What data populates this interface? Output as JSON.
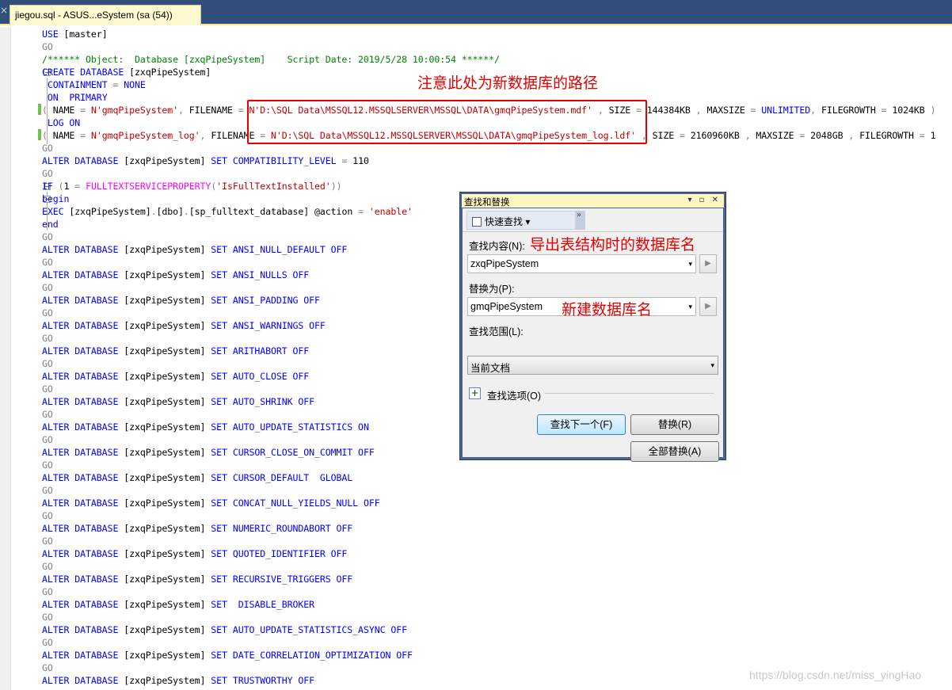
{
  "tab": {
    "title": "jiegou.sql - ASUS...eSystem (sa (54))",
    "close": "×"
  },
  "code": [
    [
      [
        "k",
        "USE "
      ],
      [
        "p",
        "[master]"
      ]
    ],
    [
      [
        "g",
        "GO"
      ]
    ],
    [
      [
        "c",
        "/****** Object:  Database [zxqPipeSystem]    Script Date: 2019/5/28 10:00:54 ******/"
      ]
    ],
    [
      [
        "k",
        "CREATE DATABASE "
      ],
      [
        "p",
        "[zxqPipeSystem]"
      ]
    ],
    [
      [
        "p",
        " "
      ],
      [
        "k",
        "CONTAINMENT "
      ],
      [
        "g",
        "= "
      ],
      [
        "k",
        "NONE"
      ]
    ],
    [
      [
        "p",
        " "
      ],
      [
        "k",
        "ON  PRIMARY"
      ]
    ],
    [
      [
        "g",
        "( "
      ],
      [
        "p",
        "NAME "
      ],
      [
        "g",
        "= "
      ],
      [
        "s",
        "N'gmqPipeSystem'"
      ],
      [
        "g",
        ", "
      ],
      [
        "p",
        "FILENAME "
      ],
      [
        "g",
        "= "
      ],
      [
        "s",
        "N'D:\\SQL Data\\MSSQL12.MSSQLSERVER\\MSSQL\\DATA\\gmqPipeSystem.mdf'"
      ],
      [
        "g",
        " , "
      ],
      [
        "p",
        "SIZE "
      ],
      [
        "g",
        "= "
      ],
      [
        "p",
        "144384KB "
      ],
      [
        "g",
        ", "
      ],
      [
        "p",
        "MAXSIZE "
      ],
      [
        "g",
        "= "
      ],
      [
        "k",
        "UNLIMITED"
      ],
      [
        "g",
        ", "
      ],
      [
        "p",
        "FILEGROWTH "
      ],
      [
        "g",
        "= "
      ],
      [
        "p",
        "1024KB "
      ],
      [
        "g",
        ")"
      ]
    ],
    [
      [
        "p",
        " "
      ],
      [
        "k",
        "LOG ON"
      ]
    ],
    [
      [
        "g",
        "( "
      ],
      [
        "p",
        "NAME "
      ],
      [
        "g",
        "= "
      ],
      [
        "s",
        "N'gmqPipeSystem_log'"
      ],
      [
        "g",
        ", "
      ],
      [
        "p",
        "FILENAME "
      ],
      [
        "g",
        "= "
      ],
      [
        "s",
        "N'D:\\SQL Data\\MSSQL12.MSSQLSERVER\\MSSQL\\DATA\\gmqPipeSystem_log.ldf'"
      ],
      [
        "g",
        " , "
      ],
      [
        "p",
        "SIZE "
      ],
      [
        "g",
        "= "
      ],
      [
        "p",
        "2160960KB "
      ],
      [
        "g",
        ", "
      ],
      [
        "p",
        "MAXSIZE "
      ],
      [
        "g",
        "= "
      ],
      [
        "p",
        "2048GB "
      ],
      [
        "g",
        ", "
      ],
      [
        "p",
        "FILEGROWTH "
      ],
      [
        "g",
        "= "
      ],
      [
        "p",
        "1"
      ]
    ],
    [
      [
        "g",
        "GO"
      ]
    ],
    [
      [
        "k",
        "ALTER DATABASE "
      ],
      [
        "p",
        "[zxqPipeSystem] "
      ],
      [
        "k",
        "SET "
      ],
      [
        "k",
        "COMPATIBILITY_LEVEL "
      ],
      [
        "g",
        "= "
      ],
      [
        "p",
        "110"
      ]
    ],
    [
      [
        "g",
        "GO"
      ]
    ],
    [
      [
        "k",
        "IF "
      ],
      [
        "g",
        "("
      ],
      [
        "p",
        "1 "
      ],
      [
        "g",
        "= "
      ],
      [
        "m",
        "FULLTEXTSERVICEPROPERTY"
      ],
      [
        "g",
        "("
      ],
      [
        "s",
        "'IsFullTextInstalled'"
      ],
      [
        "g",
        "))"
      ]
    ],
    [
      [
        "k",
        "begin"
      ]
    ],
    [
      [
        "k",
        "EXEC "
      ],
      [
        "p",
        "[zxqPipeSystem]"
      ],
      [
        "g",
        "."
      ],
      [
        "p",
        "[dbo]"
      ],
      [
        "g",
        "."
      ],
      [
        "p",
        "[sp_fulltext_database] @action "
      ],
      [
        "g",
        "= "
      ],
      [
        "s",
        "'enable'"
      ]
    ],
    [
      [
        "k",
        "end"
      ]
    ],
    [
      [
        "g",
        "GO"
      ]
    ],
    [
      [
        "k",
        "ALTER DATABASE "
      ],
      [
        "p",
        "[zxqPipeSystem] "
      ],
      [
        "k",
        "SET ANSI_NULL_DEFAULT OFF"
      ]
    ],
    [
      [
        "g",
        "GO"
      ]
    ],
    [
      [
        "k",
        "ALTER DATABASE "
      ],
      [
        "p",
        "[zxqPipeSystem] "
      ],
      [
        "k",
        "SET ANSI_NULLS OFF"
      ]
    ],
    [
      [
        "g",
        "GO"
      ]
    ],
    [
      [
        "k",
        "ALTER DATABASE "
      ],
      [
        "p",
        "[zxqPipeSystem] "
      ],
      [
        "k",
        "SET ANSI_PADDING OFF"
      ]
    ],
    [
      [
        "g",
        "GO"
      ]
    ],
    [
      [
        "k",
        "ALTER DATABASE "
      ],
      [
        "p",
        "[zxqPipeSystem] "
      ],
      [
        "k",
        "SET ANSI_WARNINGS OFF"
      ]
    ],
    [
      [
        "g",
        "GO"
      ]
    ],
    [
      [
        "k",
        "ALTER DATABASE "
      ],
      [
        "p",
        "[zxqPipeSystem] "
      ],
      [
        "k",
        "SET ARITHABORT OFF"
      ]
    ],
    [
      [
        "g",
        "GO"
      ]
    ],
    [
      [
        "k",
        "ALTER DATABASE "
      ],
      [
        "p",
        "[zxqPipeSystem] "
      ],
      [
        "k",
        "SET AUTO_CLOSE OFF"
      ]
    ],
    [
      [
        "g",
        "GO"
      ]
    ],
    [
      [
        "k",
        "ALTER DATABASE "
      ],
      [
        "p",
        "[zxqPipeSystem] "
      ],
      [
        "k",
        "SET AUTO_SHRINK OFF"
      ]
    ],
    [
      [
        "g",
        "GO"
      ]
    ],
    [
      [
        "k",
        "ALTER DATABASE "
      ],
      [
        "p",
        "[zxqPipeSystem] "
      ],
      [
        "k",
        "SET AUTO_UPDATE_STATISTICS ON"
      ]
    ],
    [
      [
        "g",
        "GO"
      ]
    ],
    [
      [
        "k",
        "ALTER DATABASE "
      ],
      [
        "p",
        "[zxqPipeSystem] "
      ],
      [
        "k",
        "SET CURSOR_CLOSE_ON_COMMIT OFF"
      ]
    ],
    [
      [
        "g",
        "GO"
      ]
    ],
    [
      [
        "k",
        "ALTER DATABASE "
      ],
      [
        "p",
        "[zxqPipeSystem] "
      ],
      [
        "k",
        "SET CURSOR_DEFAULT  GLOBAL"
      ]
    ],
    [
      [
        "g",
        "GO"
      ]
    ],
    [
      [
        "k",
        "ALTER DATABASE "
      ],
      [
        "p",
        "[zxqPipeSystem] "
      ],
      [
        "k",
        "SET CONCAT_NULL_YIELDS_NULL OFF"
      ]
    ],
    [
      [
        "g",
        "GO"
      ]
    ],
    [
      [
        "k",
        "ALTER DATABASE "
      ],
      [
        "p",
        "[zxqPipeSystem] "
      ],
      [
        "k",
        "SET NUMERIC_ROUNDABORT OFF"
      ]
    ],
    [
      [
        "g",
        "GO"
      ]
    ],
    [
      [
        "k",
        "ALTER DATABASE "
      ],
      [
        "p",
        "[zxqPipeSystem] "
      ],
      [
        "k",
        "SET QUOTED_IDENTIFIER OFF"
      ]
    ],
    [
      [
        "g",
        "GO"
      ]
    ],
    [
      [
        "k",
        "ALTER DATABASE "
      ],
      [
        "p",
        "[zxqPipeSystem] "
      ],
      [
        "k",
        "SET RECURSIVE_TRIGGERS OFF"
      ]
    ],
    [
      [
        "g",
        "GO"
      ]
    ],
    [
      [
        "k",
        "ALTER DATABASE "
      ],
      [
        "p",
        "[zxqPipeSystem] "
      ],
      [
        "k",
        "SET  DISABLE_BROKER"
      ]
    ],
    [
      [
        "g",
        "GO"
      ]
    ],
    [
      [
        "k",
        "ALTER DATABASE "
      ],
      [
        "p",
        "[zxqPipeSystem] "
      ],
      [
        "k",
        "SET AUTO_UPDATE_STATISTICS_ASYNC OFF"
      ]
    ],
    [
      [
        "g",
        "GO"
      ]
    ],
    [
      [
        "k",
        "ALTER DATABASE "
      ],
      [
        "p",
        "[zxqPipeSystem] "
      ],
      [
        "k",
        "SET DATE_CORRELATION_OPTIMIZATION OFF"
      ]
    ],
    [
      [
        "g",
        "GO"
      ]
    ],
    [
      [
        "k",
        "ALTER DATABASE "
      ],
      [
        "p",
        "[zxqPipeSystem] "
      ],
      [
        "k",
        "SET TRUSTWORTHY OFF"
      ]
    ]
  ],
  "annotations": {
    "path_note": "注意此处为新数据库的路径",
    "find_note": "导出表结构时的数据库名",
    "replace_note": "新建数据库名"
  },
  "dialog": {
    "title": "查找和替换",
    "title_controls": "▾ ▫ ✕",
    "quick_find": "快速查找",
    "quick_find_arrow": "▾",
    "more": "»",
    "find_label": "查找内容(N):",
    "find_value": "zxqPipeSystem",
    "replace_label": "替换为(P):",
    "replace_value": "gmqPipeSystem",
    "scope_label": "查找范围(L):",
    "scope_value": "当前文档",
    "options_toggle": "+",
    "options_label": "查找选项(O)",
    "find_next": "查找下一个(F)",
    "replace": "替换(R)",
    "replace_all": "全部替换(A)",
    "arrow": "▾",
    "side_arrow": "▶"
  },
  "watermark": "https://blog.csdn.net/miss_yingHao"
}
